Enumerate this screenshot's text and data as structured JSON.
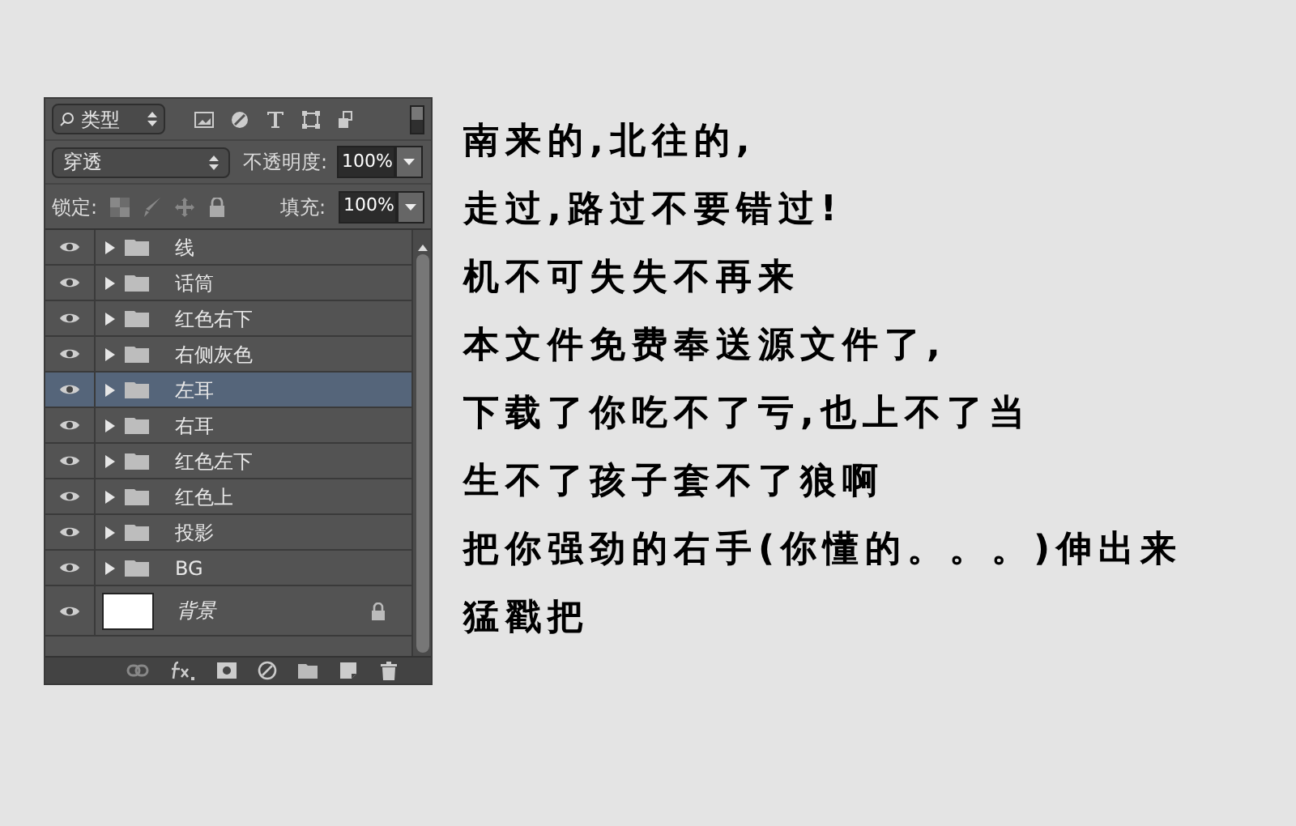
{
  "layers_panel": {
    "filter": {
      "value": "类型"
    },
    "blend_mode": {
      "value": "穿透"
    },
    "opacity": {
      "label": "不透明度:",
      "value": "100%"
    },
    "lock": {
      "label": "锁定:"
    },
    "fill": {
      "label": "填充:",
      "value": "100%"
    },
    "layers": [
      {
        "kind": "group",
        "name": "线",
        "visible": true,
        "selected": false
      },
      {
        "kind": "group",
        "name": "话筒",
        "visible": true,
        "selected": false
      },
      {
        "kind": "group",
        "name": "红色右下",
        "visible": true,
        "selected": false
      },
      {
        "kind": "group",
        "name": "右侧灰色",
        "visible": true,
        "selected": false
      },
      {
        "kind": "group",
        "name": "左耳",
        "visible": true,
        "selected": true
      },
      {
        "kind": "group",
        "name": "右耳",
        "visible": true,
        "selected": false
      },
      {
        "kind": "group",
        "name": "红色左下",
        "visible": true,
        "selected": false
      },
      {
        "kind": "group",
        "name": "红色上",
        "visible": true,
        "selected": false
      },
      {
        "kind": "group",
        "name": "投影",
        "visible": true,
        "selected": false
      },
      {
        "kind": "group",
        "name": "BG",
        "visible": true,
        "selected": false
      },
      {
        "kind": "image",
        "name": "背景",
        "visible": true,
        "selected": false,
        "locked": true
      }
    ]
  },
  "message": {
    "lines": [
      "南来的,北往的,",
      "走过,路过不要错过!",
      "机不可失失不再来",
      "本文件免费奉送源文件了,",
      "下载了你吃不了亏,也上不了当",
      "生不了孩子套不了狼啊",
      "把你强劲的右手(你懂的。。。)伸出来",
      "猛戳把"
    ]
  }
}
